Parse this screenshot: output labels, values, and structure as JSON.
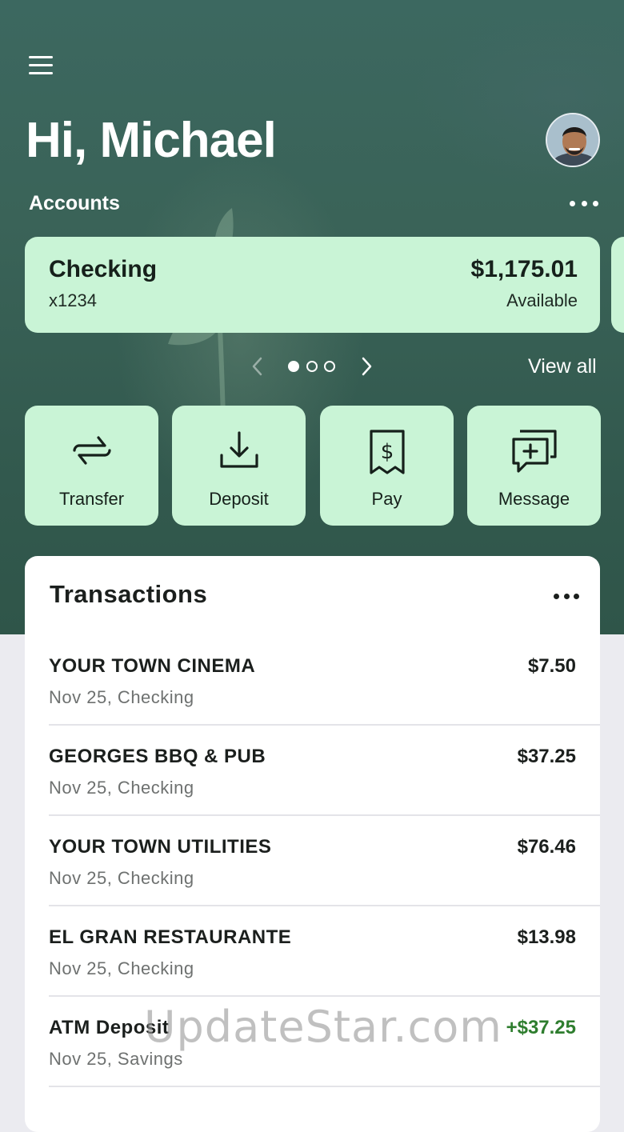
{
  "header": {
    "greeting": "Hi, Michael",
    "accounts_label": "Accounts",
    "view_all": "View all"
  },
  "account": {
    "name": "Checking",
    "number": "x1234",
    "balance": "$1,175.01",
    "balance_label": "Available"
  },
  "pager": {
    "total": 3,
    "active": 1
  },
  "actions": [
    {
      "label": "Transfer",
      "icon": "transfer-icon"
    },
    {
      "label": "Deposit",
      "icon": "deposit-icon"
    },
    {
      "label": "Pay",
      "icon": "bill-icon"
    },
    {
      "label": "Message",
      "icon": "message-add-icon"
    }
  ],
  "transactions": {
    "title": "Transactions",
    "items": [
      {
        "merchant": "YOUR TOWN CINEMA",
        "subtitle": "Nov 25, Checking",
        "amount": "$7.50"
      },
      {
        "merchant": "GEORGES BBQ & PUB",
        "subtitle": "Nov 25, Checking",
        "amount": "$37.25"
      },
      {
        "merchant": "YOUR TOWN UTILITIES",
        "subtitle": "Nov 25, Checking",
        "amount": "$76.46"
      },
      {
        "merchant": "EL GRAN RESTAURANTE",
        "subtitle": "Nov 25, Checking",
        "amount": "$13.98"
      },
      {
        "merchant": "ATM Deposit",
        "subtitle": "Nov 25, Savings",
        "amount": "+$37.25"
      }
    ]
  },
  "watermark": "UpdateStar.com",
  "colors": {
    "hero": "#3a6358",
    "card": "#c9f4d6",
    "credit": "#2e7d2e"
  }
}
